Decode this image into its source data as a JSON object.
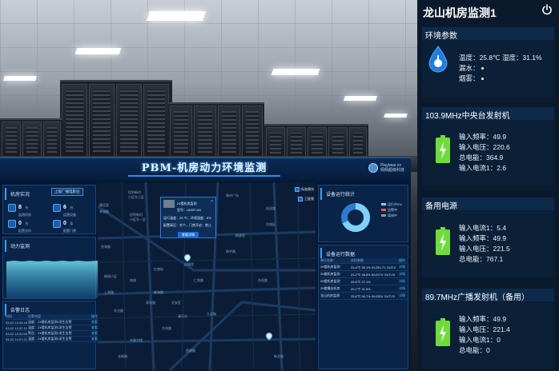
{
  "dashboard": {
    "title": "PBM-机房动力环境监测",
    "user": {
      "name": "Playbear.cn",
      "subtitle": "佩佩超级科技"
    },
    "room_status": {
      "title": "机房实况",
      "button": "上级厂播电影台",
      "stats": [
        {
          "value": "8",
          "unit": "台",
          "label": "监测机房"
        },
        {
          "value": "6",
          "unit": "台",
          "label": "运营设备"
        },
        {
          "value": "0",
          "unit": "台",
          "label": "配置总机"
        },
        {
          "value": "0",
          "unit": "条",
          "label": "配置门禁"
        }
      ]
    },
    "power_monitor": {
      "title": "动力监测"
    },
    "alarm_log": {
      "title": "告警日志",
      "headers": [
        "时间",
        "告警内容",
        "操作"
      ],
      "rows": [
        [
          "03-22 12:43:18",
          "温度：24楼机房监测1发生告警",
          "查看"
        ],
        [
          "03-22 12:37:11",
          "温度：24楼机房监测1发生告警",
          "查看"
        ],
        [
          "03-22 12:31:09",
          "警告：24楼机房监测1发生告警",
          "查看"
        ],
        [
          "03-22 12:27:21",
          "温度：24楼机房监测1发生告警",
          "查看"
        ]
      ]
    },
    "map": {
      "popup": {
        "title": "24楼机房监测",
        "model": "型号：UNSP-HD",
        "line1": "运行温度：25 ℃，环境湿度：8%",
        "line2": "配置高压：合个，门禁开启：禁止",
        "button": "查看详情",
        "close": "×"
      },
      "legend": [
        {
          "label": "标准模块"
        },
        {
          "label": "卫星频"
        }
      ],
      "labels": [
        "恒利新村",
        "小区东二区",
        "恒利新村",
        "小区东一区",
        "建设里",
        "幸福路",
        "东海路",
        "城市广场",
        "新民路",
        "仙居路",
        "东城区",
        "桃源里",
        "和平路",
        "凤城里",
        "红旗街",
        "仁和路",
        "梅园小区",
        "东阳路",
        "南湖",
        "上海路",
        "新海路",
        "天安区",
        "青年路",
        "东方路",
        "康乐村",
        "九运城",
        "大伟路",
        "市政大楼",
        "西湖路",
        "长新路",
        "新北路"
      ]
    },
    "device_stats": {
      "title": "设备运行统计",
      "legend": [
        "运行中0%",
        "告警中",
        "离线中"
      ]
    },
    "device_data": {
      "title": "设备运行数据",
      "headers": [
        "单位名称",
        "实时参数",
        "操作"
      ],
      "rows": [
        [
          "29楼机房监测",
          "23.4℃ 38.1% IN:254.7V OUT:2",
          "详情"
        ],
        [
          "29楼机房监测",
          "23.2℃ 38.8% IN:237V OUT:23",
          "详情"
        ],
        [
          "25楼机房监测",
          "28.6℃ 27.1%",
          "详情"
        ],
        [
          "29楼播出机房",
          "20.1℃ 31.5%",
          "详情"
        ],
        [
          "龙山机房监测",
          "25.8℃ 56.7% IN:235V OUT:22",
          "详情"
        ]
      ]
    }
  },
  "sidebar": {
    "title": "龙山机房监测1",
    "env": {
      "header": "环境参数",
      "line1": "温度：25.8℃ 湿度：31.1%",
      "line2": "漏水：",
      "line3": "烟雾："
    },
    "sections": [
      {
        "header": "103.9MHz中央台发射机",
        "lines": [
          "输入频率：49.9",
          "输入电压：220.6",
          "总电能：364.9",
          "输入电流1：2.6"
        ]
      },
      {
        "header": "备用电源",
        "lines": [
          "输入电流1：5.4",
          "输入频率：49.9",
          "输入电压：221.5",
          "总电能：767.1"
        ]
      },
      {
        "header": "89.7MHz广播发射机（备用）",
        "lines": [
          "输入频率：49.9",
          "输入电压：221.4",
          "输入电流1：0",
          "总电能：0"
        ]
      }
    ]
  },
  "colors": {
    "accent": "#3aa0ff",
    "battery": "#6fdc3c",
    "drop": "#1e7de0"
  }
}
